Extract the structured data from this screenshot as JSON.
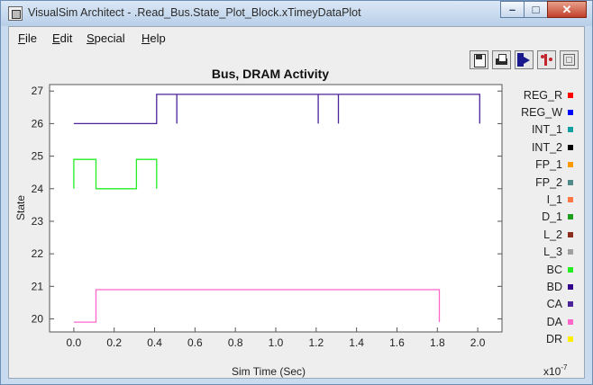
{
  "window": {
    "title": "VisualSim Architect - .Read_Bus.State_Plot_Block.xTimeyDataPlot",
    "minimize_glyph": "–",
    "maximize_glyph": "□",
    "close_glyph": "✕"
  },
  "menu": [
    {
      "mnemonic": "F",
      "rest": "ile"
    },
    {
      "mnemonic": "E",
      "rest": "dit"
    },
    {
      "mnemonic": "S",
      "rest": "pecial"
    },
    {
      "mnemonic": "H",
      "rest": "elp"
    }
  ],
  "toolbar": [
    {
      "name": "save-icon"
    },
    {
      "name": "print-icon"
    },
    {
      "name": "navigate-icon"
    },
    {
      "name": "fill-icon"
    },
    {
      "name": "reset-zoom-icon"
    }
  ],
  "legend": [
    {
      "label": "REG_R",
      "color": "#ff0000"
    },
    {
      "label": "REG_W",
      "color": "#0000ff"
    },
    {
      "label": "INT_1",
      "color": "#14a0a0"
    },
    {
      "label": "INT_2",
      "color": "#000000"
    },
    {
      "label": "FP_1",
      "color": "#ff9900"
    },
    {
      "label": "FP_2",
      "color": "#508a8a"
    },
    {
      "label": "I_1",
      "color": "#ff7744"
    },
    {
      "label": "D_1",
      "color": "#1e9e1e"
    },
    {
      "label": "L_2",
      "color": "#8b2e1e"
    },
    {
      "label": "L_3",
      "color": "#a0a0a0"
    },
    {
      "label": "BC",
      "color": "#22ee22"
    },
    {
      "label": "BD",
      "color": "#33008f"
    },
    {
      "label": "CA",
      "color": "#4d2399"
    },
    {
      "label": "DA",
      "color": "#ff66cc"
    },
    {
      "label": "DR",
      "color": "#ffee00"
    }
  ],
  "chart_data": {
    "type": "line",
    "title": "Bus, DRAM Activity",
    "xlabel": "Sim Time (Sec)",
    "ylabel": "State",
    "x_multiplier": "x10",
    "x_multiplier_exp": "-7",
    "xlim": [
      -0.12,
      2.12
    ],
    "ylim": [
      19.6,
      27.2
    ],
    "x_ticks": [
      0.0,
      0.2,
      0.4,
      0.6,
      0.8,
      1.0,
      1.2,
      1.4,
      1.6,
      1.8,
      2.0
    ],
    "x_tick_labels": [
      "0.0",
      "0.2",
      "0.4",
      "0.6",
      "0.8",
      "1.0",
      "1.2",
      "1.4",
      "1.6",
      "1.8",
      "2.0"
    ],
    "y_ticks": [
      20,
      21,
      22,
      23,
      24,
      25,
      26,
      27
    ],
    "y_tick_labels": [
      "20",
      "21",
      "22",
      "23",
      "24",
      "25",
      "26",
      "27"
    ],
    "grid": false,
    "series": [
      {
        "color": "#4d2399",
        "points": [
          [
            0.0,
            26
          ],
          [
            0.41,
            26
          ],
          [
            0.41,
            26.9
          ],
          [
            0.51,
            26.9
          ],
          [
            0.51,
            26
          ],
          [
            0.51,
            26.9
          ],
          [
            1.21,
            26.9
          ],
          [
            1.21,
            26
          ],
          [
            1.21,
            26.9
          ],
          [
            1.31,
            26.9
          ],
          [
            1.31,
            26
          ],
          [
            1.31,
            26.9
          ],
          [
            2.01,
            26.9
          ],
          [
            2.01,
            26
          ]
        ]
      },
      {
        "color": "#22ee22",
        "points": [
          [
            0.0,
            24
          ],
          [
            0.0,
            24.9
          ],
          [
            0.11,
            24.9
          ],
          [
            0.11,
            24
          ],
          [
            0.31,
            24
          ],
          [
            0.31,
            24.9
          ],
          [
            0.41,
            24.9
          ],
          [
            0.41,
            24
          ]
        ]
      },
      {
        "color": "#ff66cc",
        "points": [
          [
            0.0,
            19.9
          ],
          [
            0.11,
            19.9
          ],
          [
            0.11,
            20.9
          ],
          [
            1.81,
            20.9
          ],
          [
            1.81,
            19.9
          ]
        ]
      }
    ]
  }
}
